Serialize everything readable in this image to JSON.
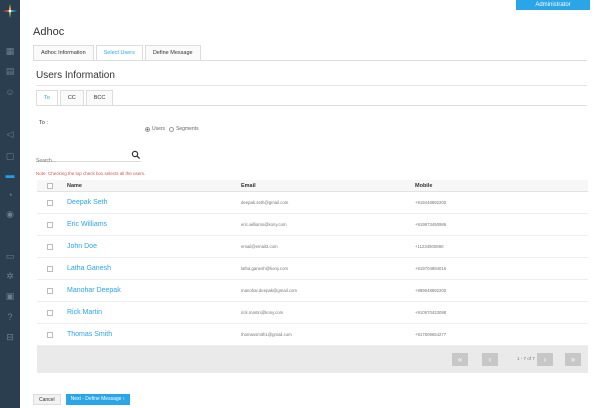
{
  "header": {
    "admin_label": "Administrator"
  },
  "page": {
    "title": "Adhoc"
  },
  "top_tabs": [
    {
      "label": "Adhoc Information",
      "active": false
    },
    {
      "label": "Select Users",
      "active": true
    },
    {
      "label": "Define Message",
      "active": false
    }
  ],
  "section": {
    "title": "Users Information"
  },
  "recipient_tabs": [
    {
      "label": "To",
      "active": true
    },
    {
      "label": "CC",
      "active": false
    },
    {
      "label": "BCC",
      "active": false
    }
  ],
  "to_label": "To :",
  "radios": {
    "users": "Users",
    "segments": "Segments",
    "selected": "users"
  },
  "search": {
    "placeholder": "Search..."
  },
  "note": "Note: Checking the top check box selects all the users.",
  "table": {
    "headers": {
      "name": "Name",
      "email": "Email",
      "mobile": "Mobile"
    },
    "rows": [
      {
        "name": "Deepak Seth",
        "email": "deepak.seth@gmail.com",
        "mobile": "+919448892200"
      },
      {
        "name": "Eric Williams",
        "email": "eric.williams@kony.com",
        "mobile": "+919873450986"
      },
      {
        "name": "John Doe",
        "email": "email@email3.com",
        "mobile": "+11234500890"
      },
      {
        "name": "Latha Ganesh",
        "email": "latha.ganesh@kony.com",
        "mobile": "+919704894016"
      },
      {
        "name": "Manohar Deepak",
        "email": "manohar.deepak@gmail.com",
        "mobile": "+989648892200"
      },
      {
        "name": "Rick Martin",
        "email": "rick.martin@kony.com",
        "mobile": "+910970423098"
      },
      {
        "name": "Thomas Smith",
        "email": "thomassmith1@gmail.com",
        "mobile": "+917809654277"
      }
    ]
  },
  "pagination": {
    "info": "1 - 7 of 7"
  },
  "footer": {
    "cancel": "Cancel",
    "next": "Next - Define Message ›"
  },
  "colors": {
    "accent": "#2aa5e8",
    "sidebar": "#2b3e50",
    "note": "#d9534f"
  },
  "icons": {
    "sidebar": [
      "apps-icon",
      "grid-icon",
      "users-icon",
      "megaphone-icon",
      "chat-icon",
      "message-icon",
      "clock-icon",
      "location-icon",
      "document-icon",
      "gear-icon",
      "report-icon",
      "help-icon",
      "messages-icon"
    ]
  }
}
